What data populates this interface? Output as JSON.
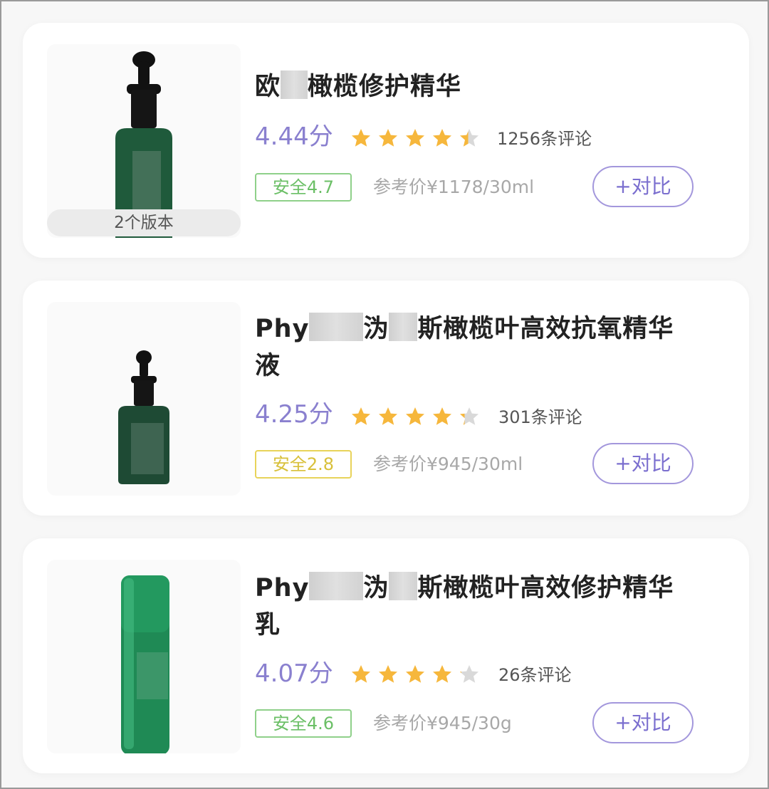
{
  "products": [
    {
      "title_parts": [
        "欧",
        "",
        "橄榄修护精华"
      ],
      "title_line2": "",
      "score": "4.44分",
      "rating": 4.44,
      "reviews": "1256条评论",
      "safety": "安全4.7",
      "safety_color": "#6bbf66",
      "price": "参考价¥1178/30ml",
      "compare": "+对比",
      "versions": "2个版本"
    },
    {
      "title_parts": [
        "Phy",
        "",
        "沩",
        "",
        "斯橄榄叶高效抗氧精华"
      ],
      "title_line2": "液",
      "score": "4.25分",
      "rating": 4.25,
      "reviews": "301条评论",
      "safety": "安全2.8",
      "safety_color": "#d8c03a",
      "price": "参考价¥945/30ml",
      "compare": "+对比"
    },
    {
      "title_parts": [
        "Phy",
        "",
        "沩",
        "",
        "斯橄榄叶高效修护精华"
      ],
      "title_line2": "乳",
      "score": "4.07分",
      "rating": 4.07,
      "reviews": "26条评论",
      "safety": "安全4.6",
      "safety_color": "#6bbf66",
      "price": "参考价¥945/30g",
      "compare": "+对比"
    }
  ],
  "icons": {
    "star": "star-icon",
    "bottle": "dropper-bottle-icon",
    "tube": "serum-tube-icon"
  },
  "colors": {
    "accent": "#8a80cf",
    "star_filled": "#f6b73c",
    "star_empty": "#d9d9d9"
  }
}
